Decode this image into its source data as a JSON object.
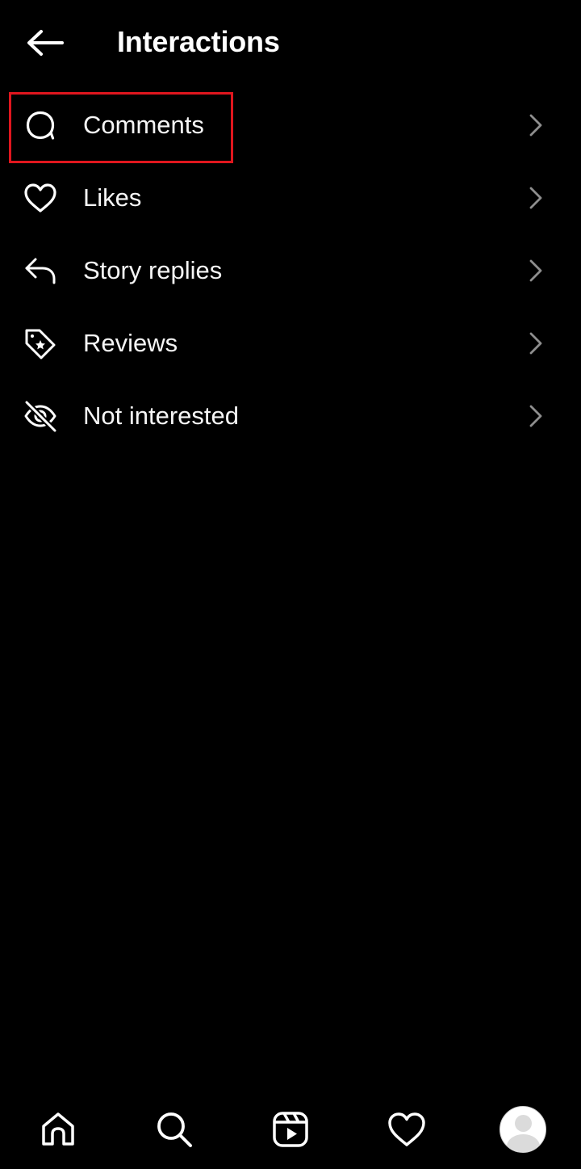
{
  "header": {
    "title": "Interactions",
    "back_icon": "arrow-left-icon"
  },
  "menu": {
    "items": [
      {
        "label": "Comments",
        "icon": "comment-bubble-icon"
      },
      {
        "label": "Likes",
        "icon": "heart-icon"
      },
      {
        "label": "Story replies",
        "icon": "reply-arrow-icon"
      },
      {
        "label": "Reviews",
        "icon": "tag-star-icon"
      },
      {
        "label": "Not interested",
        "icon": "eye-slash-icon"
      }
    ],
    "chevron_icon": "chevron-right-icon",
    "highlighted_index": 0
  },
  "tabbar": {
    "items": [
      {
        "icon": "home-icon"
      },
      {
        "icon": "search-icon"
      },
      {
        "icon": "reels-icon"
      },
      {
        "icon": "heart-icon"
      },
      {
        "icon": "profile-avatar"
      }
    ]
  },
  "colors": {
    "background": "#000000",
    "text": "#ffffff",
    "chevron": "#8e8e8e",
    "highlight": "#e0161e"
  }
}
